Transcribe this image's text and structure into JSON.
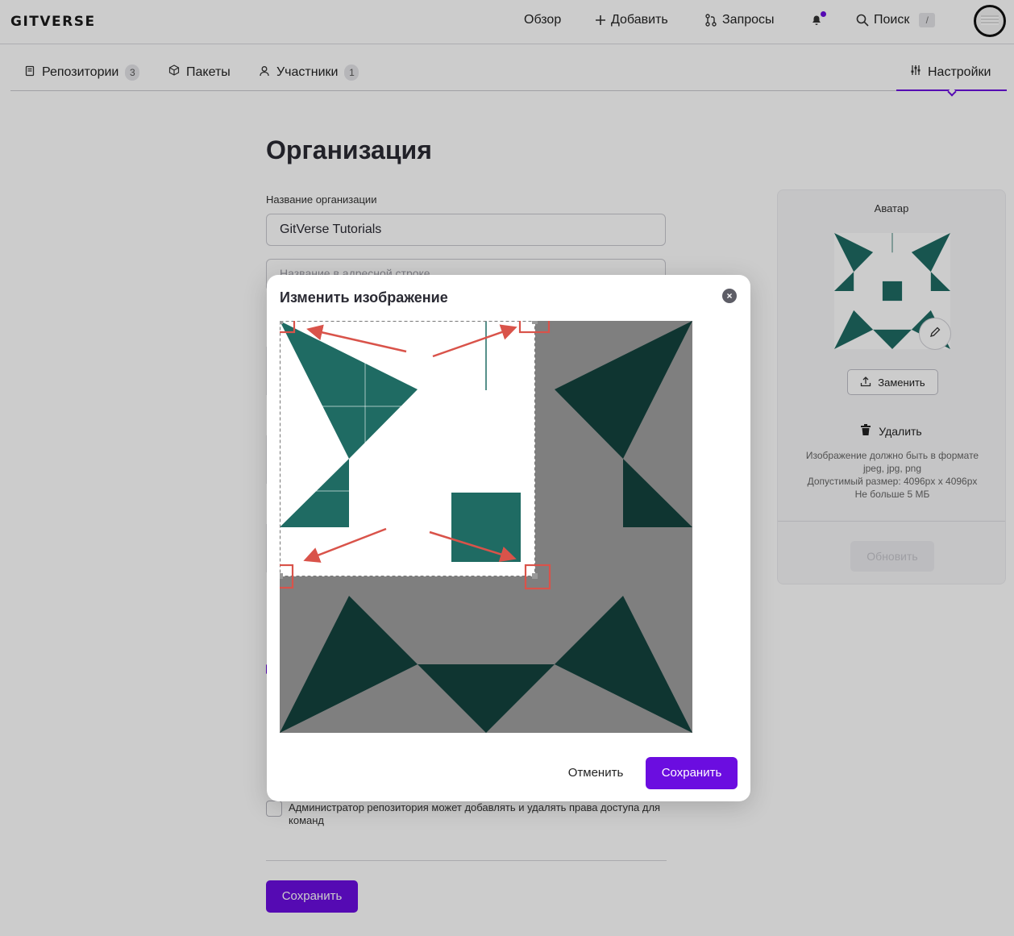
{
  "header": {
    "logo": "GITVERSE",
    "nav": {
      "overview": "Обзор",
      "add": "Добавить",
      "requests": "Запросы",
      "search": "Поиск",
      "search_shortcut": "/"
    }
  },
  "tabs": [
    {
      "label": "Репозитории",
      "count": "3"
    },
    {
      "label": "Пакеты"
    },
    {
      "label": "Участники",
      "count": "1"
    },
    {
      "label": "Настройки",
      "active": true
    }
  ],
  "page": {
    "title": "Организация",
    "org_name_label": "Название организации",
    "org_name_value": "GitVerse Tutorials",
    "url_name_placeholder": "Название в адресной строке",
    "admin_checkbox_label": "Администратор репозитория может добавлять и удалять права доступа для команд",
    "save_label": "Сохранить"
  },
  "avatar_card": {
    "title": "Аватар",
    "replace_label": "Заменить",
    "delete_label": "Удалить",
    "hint_lines": [
      "Изображение должно быть в формате",
      "jpeg, jpg, png",
      "Допустимый размер: 4096px x 4096px",
      "Не больше 5 МБ"
    ],
    "update_label": "Обновить"
  },
  "modal": {
    "title": "Изменить изображение",
    "cancel_label": "Отменить",
    "save_label": "Сохранить"
  },
  "colors": {
    "accent": "#6b0de0",
    "identicon": "#1f6b63",
    "identicon_dark": "#10373a",
    "annotation": "#d9534a"
  }
}
